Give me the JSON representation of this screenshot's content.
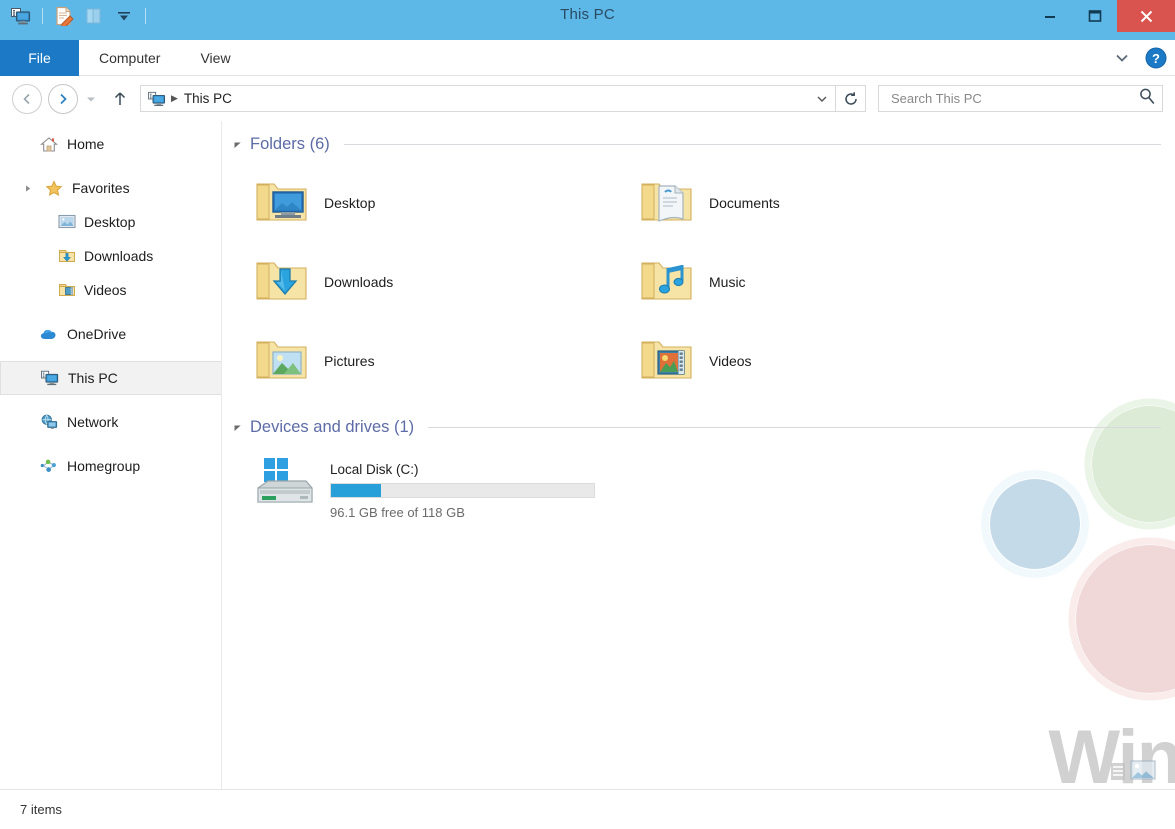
{
  "window": {
    "title": "This PC",
    "accent_titlebar": "#5db8e8",
    "accent_file_tab": "#1b79c6",
    "close_button_color": "#d9534f",
    "section_header_color": "#5d6ba6",
    "progress_fill_color": "#27a0da"
  },
  "quick_access_toolbar": {
    "items": [
      {
        "name": "this-pc-icon",
        "label": "This PC"
      },
      {
        "name": "properties-icon",
        "label": "Properties"
      },
      {
        "name": "new-folder-icon",
        "label": "New folder"
      },
      {
        "name": "customize-dropdown-icon",
        "label": "Customize Quick Access Toolbar"
      }
    ]
  },
  "window_controls": {
    "minimize": "Minimize",
    "maximize": "Maximize",
    "close": "Close"
  },
  "ribbon": {
    "tabs": [
      {
        "label": "File",
        "active": true
      },
      {
        "label": "Computer",
        "active": false
      },
      {
        "label": "View",
        "active": false
      }
    ],
    "expand_label": "Expand the Ribbon",
    "help_label": "Help"
  },
  "address_bar": {
    "back_label": "Back",
    "forward_label": "Forward",
    "recent_label": "Recent locations",
    "up_label": "Up to Previous",
    "breadcrumb": {
      "icon": "this-pc-icon",
      "path": "This PC",
      "dropdown_label": "Previous Locations"
    },
    "refresh_label": "Refresh"
  },
  "search": {
    "placeholder": "Search This PC",
    "value": "",
    "icon": "search-icon"
  },
  "sidebar": {
    "items": [
      {
        "label": "Home",
        "icon": "home-icon",
        "level": 0,
        "expandable": false,
        "selected": false,
        "gap": false
      },
      {
        "label": "Favorites",
        "icon": "star-icon",
        "level": 0,
        "expandable": true,
        "selected": false,
        "gap": true
      },
      {
        "label": "Desktop",
        "icon": "desktop-picture-icon",
        "level": 1,
        "expandable": false,
        "selected": false,
        "gap": false
      },
      {
        "label": "Downloads",
        "icon": "downloads-folder-icon",
        "level": 1,
        "expandable": false,
        "selected": false,
        "gap": false
      },
      {
        "label": "Videos",
        "icon": "videos-folder-icon",
        "level": 1,
        "expandable": false,
        "selected": false,
        "gap": false
      },
      {
        "label": "OneDrive",
        "icon": "onedrive-cloud-icon",
        "level": 0,
        "expandable": false,
        "selected": false,
        "gap": true
      },
      {
        "label": "This PC",
        "icon": "this-pc-icon",
        "level": 0,
        "expandable": false,
        "selected": true,
        "gap": true
      },
      {
        "label": "Network",
        "icon": "network-icon",
        "level": 0,
        "expandable": false,
        "selected": false,
        "gap": true
      },
      {
        "label": "Homegroup",
        "icon": "homegroup-icon",
        "level": 0,
        "expandable": false,
        "selected": false,
        "gap": true
      }
    ]
  },
  "main": {
    "sections": [
      {
        "id": "folders",
        "header": "Folders (6)",
        "collapsed": false,
        "items": [
          {
            "label": "Desktop",
            "icon": "desktop-folder-icon"
          },
          {
            "label": "Documents",
            "icon": "documents-folder-icon"
          },
          {
            "label": "Downloads",
            "icon": "downloads-folder-icon"
          },
          {
            "label": "Music",
            "icon": "music-folder-icon"
          },
          {
            "label": "Pictures",
            "icon": "pictures-folder-icon"
          },
          {
            "label": "Videos",
            "icon": "videos-folder-icon"
          }
        ]
      },
      {
        "id": "devices",
        "header": "Devices and drives (1)",
        "collapsed": false,
        "drives": [
          {
            "name": "Local Disk (C:)",
            "icon": "local-disk-icon",
            "free_text": "96.1 GB free of 118 GB",
            "free_gb": 96.1,
            "total_gb": 118,
            "used_percent": 19
          }
        ]
      }
    ]
  },
  "status_bar": {
    "item_count": "7 items"
  },
  "watermark": {
    "text": "Win",
    "circles": [
      {
        "color": "#bfdcb5",
        "name": "green-circle"
      },
      {
        "color": "#a9c7dd",
        "name": "blue-circle"
      },
      {
        "color": "#e4b9ba",
        "name": "red-circle"
      }
    ]
  }
}
